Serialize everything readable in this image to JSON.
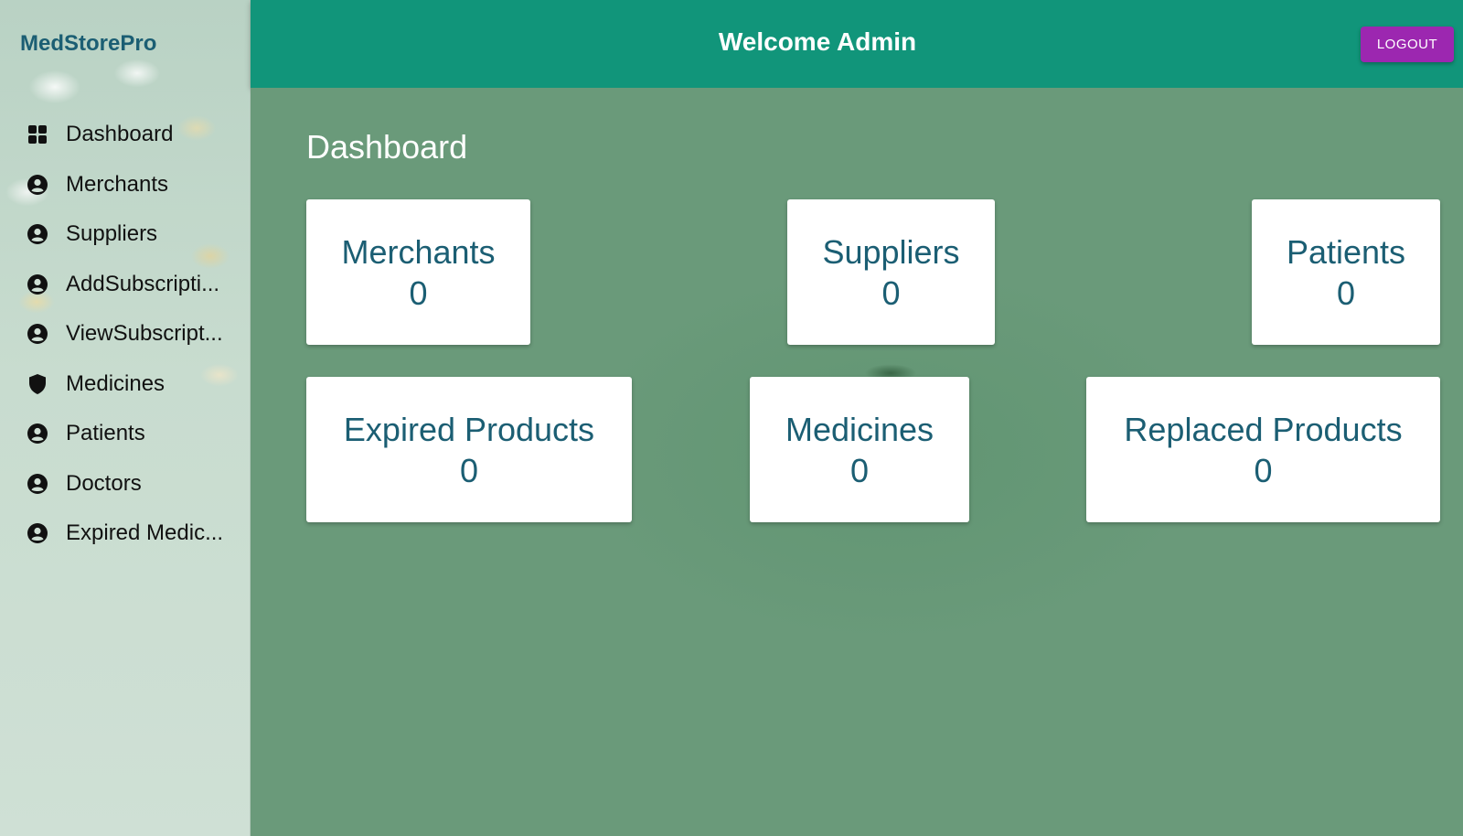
{
  "sidebar": {
    "brand": "MedStorePro",
    "items": [
      {
        "label": "Dashboard",
        "icon": "dashboard-icon"
      },
      {
        "label": "Merchants",
        "icon": "account-circle-icon"
      },
      {
        "label": "Suppliers",
        "icon": "account-circle-icon"
      },
      {
        "label": "AddSubscripti...",
        "icon": "account-circle-icon"
      },
      {
        "label": "ViewSubscript...",
        "icon": "account-circle-icon"
      },
      {
        "label": "Medicines",
        "icon": "shield-icon"
      },
      {
        "label": "Patients",
        "icon": "account-circle-icon"
      },
      {
        "label": "Doctors",
        "icon": "account-circle-icon"
      },
      {
        "label": "Expired Medic...",
        "icon": "account-circle-icon"
      }
    ]
  },
  "header": {
    "title": "Welcome Admin",
    "logout_label": "LOGOUT"
  },
  "main": {
    "title": "Dashboard",
    "cards": [
      {
        "label": "Merchants",
        "value": "0"
      },
      {
        "label": "Suppliers",
        "value": "0"
      },
      {
        "label": "Patients",
        "value": "0"
      },
      {
        "label": "Expired Products",
        "value": "0"
      },
      {
        "label": "Medicines",
        "value": "0"
      },
      {
        "label": "Replaced Products",
        "value": "0"
      }
    ]
  },
  "colors": {
    "header": "#11957a",
    "logout_button": "#9c27b0",
    "accent_text": "#1b5e73",
    "background": "#6a9a7a"
  }
}
